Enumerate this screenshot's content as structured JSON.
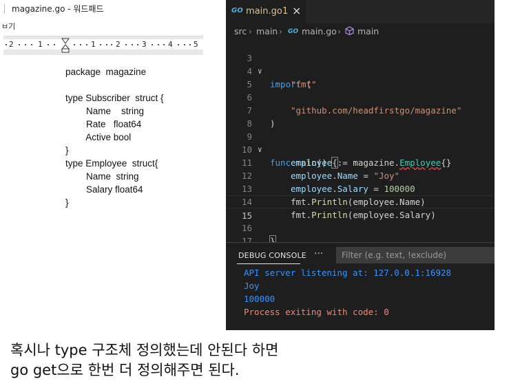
{
  "wordpad": {
    "title": "magazine.go - 워드패드",
    "menu_fragment": "ㅂ기",
    "ruler_labels": [
      "2",
      "1",
      "1",
      "2",
      "3",
      "4",
      "5"
    ],
    "document_lines": [
      "package  magazine",
      "",
      "type Subscriber  struct {",
      "        Name    string",
      "        Rate   float64",
      "        Active bool",
      "}",
      "type Employee  struct{",
      "        Name  string",
      "        Salary float64",
      "}"
    ]
  },
  "vscode": {
    "tab": {
      "icon": "GO",
      "filename": "main.go",
      "problem_count": "1",
      "close_glyph": "×"
    },
    "breadcrumb": {
      "src": "src",
      "main_folder": "main",
      "go_icon": "GO",
      "file": "main.go",
      "symbol": "main"
    },
    "editor": {
      "line_numbers": [
        "3",
        "4",
        "5",
        "6",
        "7",
        "8",
        "9",
        "10",
        "11",
        "12",
        "13",
        "14",
        "15",
        "16",
        "17"
      ],
      "active_line": "15",
      "code": {
        "l3_kw": "import",
        "l3_paren": " (",
        "l4_str": "\"fmt\"",
        "l6_str": "\"github.com/headfirstgo/magazine\"",
        "l7": ")",
        "l9_kw": "func",
        "l9_fn": "main",
        "l9_parens": "() ",
        "l9_brace": "{",
        "l10_var": "employee",
        "l10_op": " := ",
        "l10_pkg": "magazine",
        "l10_dot": ".",
        "l10_type": "Employee",
        "l10_braces": "{}",
        "l11_var": "employee",
        "l11_dot": ".",
        "l11_field": "Name",
        "l11_op": " = ",
        "l11_str": "\"Joy\"",
        "l12_var": "employee",
        "l12_dot": ".",
        "l12_field": "Salary",
        "l12_op": " = ",
        "l12_num": "100000",
        "l13_pkg": "fmt",
        "l13_dot": ".",
        "l13_fn": "Println",
        "l13_args": "(employee.Name)",
        "l14_pkg": "fmt",
        "l14_dot": ".",
        "l14_fn": "Println",
        "l14_args": "(employee.Salary)",
        "l16": "}"
      }
    },
    "debug_panel": {
      "title": "DEBUG CONSOLE",
      "more": "···",
      "filter_placeholder": "Filter (e.g. text, !exclude)",
      "output": [
        "API server listening at: 127.0.0.1:16928",
        "Joy",
        "100000",
        "Process exiting with code: 0"
      ]
    }
  },
  "caption": {
    "line1": "혹시나 type 구조체 정의했는데 안된다 하면",
    "line2": "go get으로 한번 더 정의해주면 된다."
  },
  "colors": {
    "vscode_bg": "#1e1e1e",
    "keyword": "#569cd6",
    "string": "#ce9178",
    "function": "#dcdcaa",
    "variable": "#9cdcfe",
    "type": "#4ec9b0",
    "number": "#b5cea8",
    "console_output": "#3794ff",
    "console_exit": "#f48771",
    "tab_modified": "#e2c08d"
  }
}
